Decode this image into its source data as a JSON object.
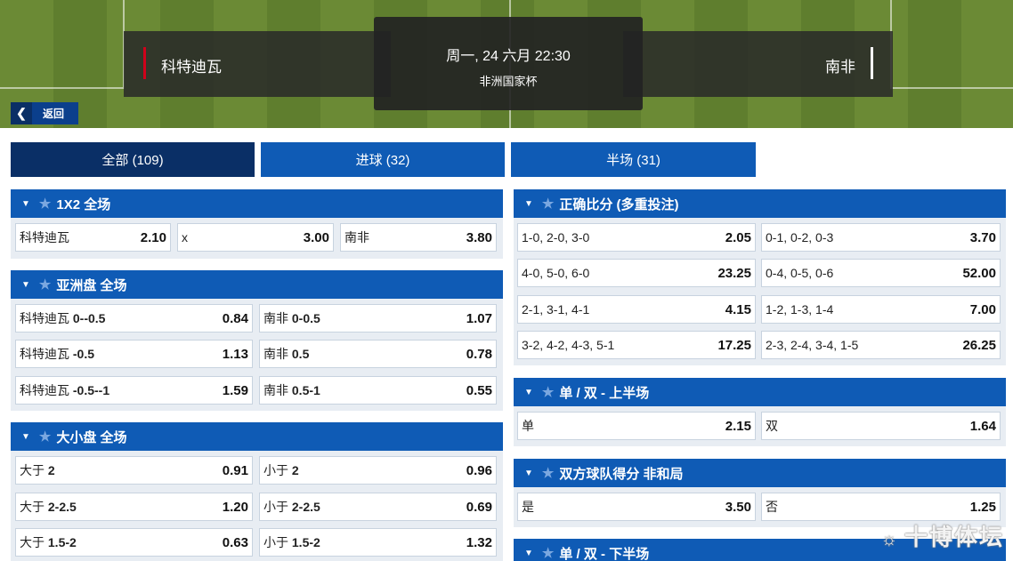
{
  "header": {
    "home_team": "科特迪瓦",
    "away_team": "南非",
    "datetime": "周一, 24 六月 22:30",
    "league": "非洲国家杯",
    "back_label": "返回"
  },
  "tabs": [
    {
      "label": "全部 (109)",
      "active": true
    },
    {
      "label": "进球 (32)",
      "active": false
    },
    {
      "label": "半场 (31)",
      "active": false
    }
  ],
  "markets": {
    "m1x2": {
      "title": "1X2 全场",
      "selections": [
        {
          "label": "科特迪瓦",
          "odd": "2.10"
        },
        {
          "label": "x",
          "odd": "3.00"
        },
        {
          "label": "南非",
          "odd": "3.80"
        }
      ]
    },
    "asian": {
      "title": "亚洲盘 全场",
      "rows": [
        [
          {
            "team": "科特迪瓦",
            "line": "0--0.5",
            "odd": "0.84"
          },
          {
            "team": "南非",
            "line": "0-0.5",
            "odd": "1.07"
          }
        ],
        [
          {
            "team": "科特迪瓦",
            "line": "-0.5",
            "odd": "1.13"
          },
          {
            "team": "南非",
            "line": "0.5",
            "odd": "0.78"
          }
        ],
        [
          {
            "team": "科特迪瓦",
            "line": "-0.5--1",
            "odd": "1.59"
          },
          {
            "team": "南非",
            "line": "0.5-1",
            "odd": "0.55"
          }
        ]
      ]
    },
    "totals": {
      "title": "大小盘 全场",
      "rows": [
        [
          {
            "team": "大于",
            "line": "2",
            "odd": "0.91"
          },
          {
            "team": "小于",
            "line": "2",
            "odd": "0.96"
          }
        ],
        [
          {
            "team": "大于",
            "line": "2-2.5",
            "odd": "1.20"
          },
          {
            "team": "小于",
            "line": "2-2.5",
            "odd": "0.69"
          }
        ],
        [
          {
            "team": "大于",
            "line": "1.5-2",
            "odd": "0.63"
          },
          {
            "team": "小于",
            "line": "1.5-2",
            "odd": "1.32"
          }
        ]
      ]
    },
    "correct_score": {
      "title": "正确比分 (多重投注)",
      "rows": [
        [
          {
            "label": "1-0, 2-0, 3-0",
            "odd": "2.05"
          },
          {
            "label": "0-1, 0-2, 0-3",
            "odd": "3.70"
          }
        ],
        [
          {
            "label": "4-0, 5-0, 6-0",
            "odd": "23.25"
          },
          {
            "label": "0-4, 0-5, 0-6",
            "odd": "52.00"
          }
        ],
        [
          {
            "label": "2-1, 3-1, 4-1",
            "odd": "4.15"
          },
          {
            "label": "1-2, 1-3, 1-4",
            "odd": "7.00"
          }
        ],
        [
          {
            "label": "3-2, 4-2, 4-3, 5-1",
            "odd": "17.25"
          },
          {
            "label": "2-3, 2-4, 3-4, 1-5",
            "odd": "26.25"
          }
        ]
      ]
    },
    "odd_even_1h": {
      "title": "单 / 双 - 上半场",
      "selections": [
        {
          "label": "单",
          "odd": "2.15"
        },
        {
          "label": "双",
          "odd": "1.64"
        }
      ]
    },
    "btts": {
      "title": "双方球队得分 非和局",
      "selections": [
        {
          "label": "是",
          "odd": "3.50"
        },
        {
          "label": "否",
          "odd": "1.25"
        }
      ]
    },
    "odd_even_2h": {
      "title": "单 / 双 - 下半场"
    }
  },
  "watermark": "十博体坛",
  "icons": {
    "collapse": "triangle-down-icon",
    "favorite": "star-icon",
    "back": "chevron-left-icon",
    "weibo": "weibo-logo-icon"
  },
  "colors": {
    "primary": "#0f5bb5",
    "primary_dark": "#0a2f66",
    "home_mark": "#d0021b"
  }
}
